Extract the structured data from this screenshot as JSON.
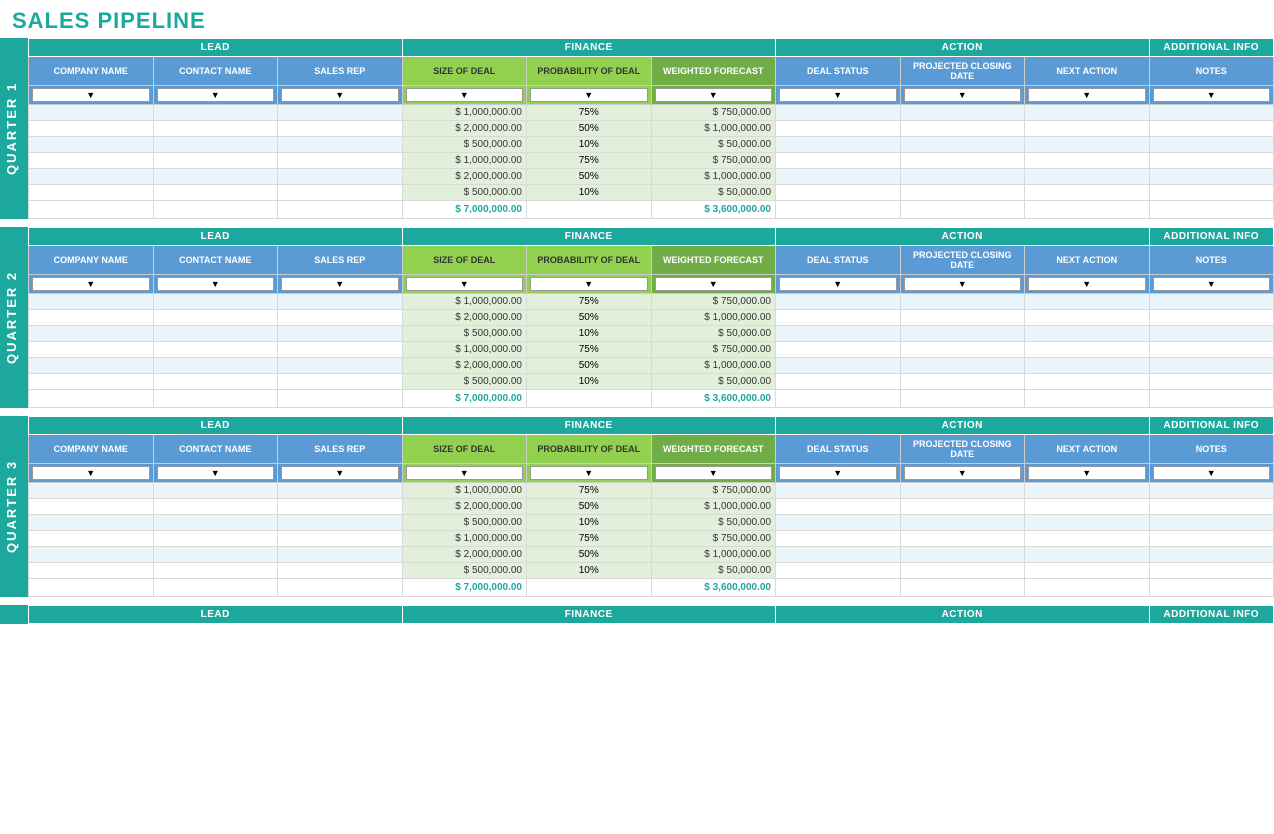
{
  "page": {
    "title": "SALES PIPELINE"
  },
  "sections": {
    "lead": "LEAD",
    "finance": "FINANCE",
    "action": "ACTION",
    "additional_info": "ADDITIONAL INFO"
  },
  "columns": {
    "company_name": "COMPANY NAME",
    "contact_name": "CONTACT NAME",
    "sales_rep": "SALES REP",
    "size_of_deal": "SIZE OF DEAL",
    "probability_of_deal": "PROBABILITY OF DEAL",
    "weighted_forecast": "WEIGHTED FORECAST",
    "deal_status": "DEAL STATUS",
    "projected_closing_date": "PROJECTED CLOSING DATE",
    "next_action": "NEXT ACTION",
    "notes": "NOTES"
  },
  "quarters": [
    {
      "label": "QUARTER 1",
      "rows": [
        {
          "size": "$ 1,000,000.00",
          "prob": "75%",
          "weighted": "$ 750,000.00"
        },
        {
          "size": "$ 2,000,000.00",
          "prob": "50%",
          "weighted": "$ 1,000,000.00"
        },
        {
          "size": "$ 500,000.00",
          "prob": "10%",
          "weighted": "$ 50,000.00"
        },
        {
          "size": "$ 1,000,000.00",
          "prob": "75%",
          "weighted": "$ 750,000.00"
        },
        {
          "size": "$ 2,000,000.00",
          "prob": "50%",
          "weighted": "$ 1,000,000.00"
        },
        {
          "size": "$ 500,000.00",
          "prob": "10%",
          "weighted": "$ 50,000.00"
        }
      ],
      "total_size": "$ 7,000,000.00",
      "total_weighted": "$ 3,600,000.00"
    },
    {
      "label": "QUARTER 2",
      "rows": [
        {
          "size": "$ 1,000,000.00",
          "prob": "75%",
          "weighted": "$ 750,000.00"
        },
        {
          "size": "$ 2,000,000.00",
          "prob": "50%",
          "weighted": "$ 1,000,000.00"
        },
        {
          "size": "$ 500,000.00",
          "prob": "10%",
          "weighted": "$ 50,000.00"
        },
        {
          "size": "$ 1,000,000.00",
          "prob": "75%",
          "weighted": "$ 750,000.00"
        },
        {
          "size": "$ 2,000,000.00",
          "prob": "50%",
          "weighted": "$ 1,000,000.00"
        },
        {
          "size": "$ 500,000.00",
          "prob": "10%",
          "weighted": "$ 50,000.00"
        }
      ],
      "total_size": "$ 7,000,000.00",
      "total_weighted": "$ 3,600,000.00"
    },
    {
      "label": "QUARTER 3",
      "rows": [
        {
          "size": "$ 1,000,000.00",
          "prob": "75%",
          "weighted": "$ 750,000.00"
        },
        {
          "size": "$ 2,000,000.00",
          "prob": "50%",
          "weighted": "$ 1,000,000.00"
        },
        {
          "size": "$ 500,000.00",
          "prob": "10%",
          "weighted": "$ 50,000.00"
        },
        {
          "size": "$ 1,000,000.00",
          "prob": "75%",
          "weighted": "$ 750,000.00"
        },
        {
          "size": "$ 2,000,000.00",
          "prob": "50%",
          "weighted": "$ 1,000,000.00"
        },
        {
          "size": "$ 500,000.00",
          "prob": "10%",
          "weighted": "$ 50,000.00"
        }
      ],
      "total_size": "$ 7,000,000.00",
      "total_weighted": "$ 3,600,000.00"
    }
  ]
}
